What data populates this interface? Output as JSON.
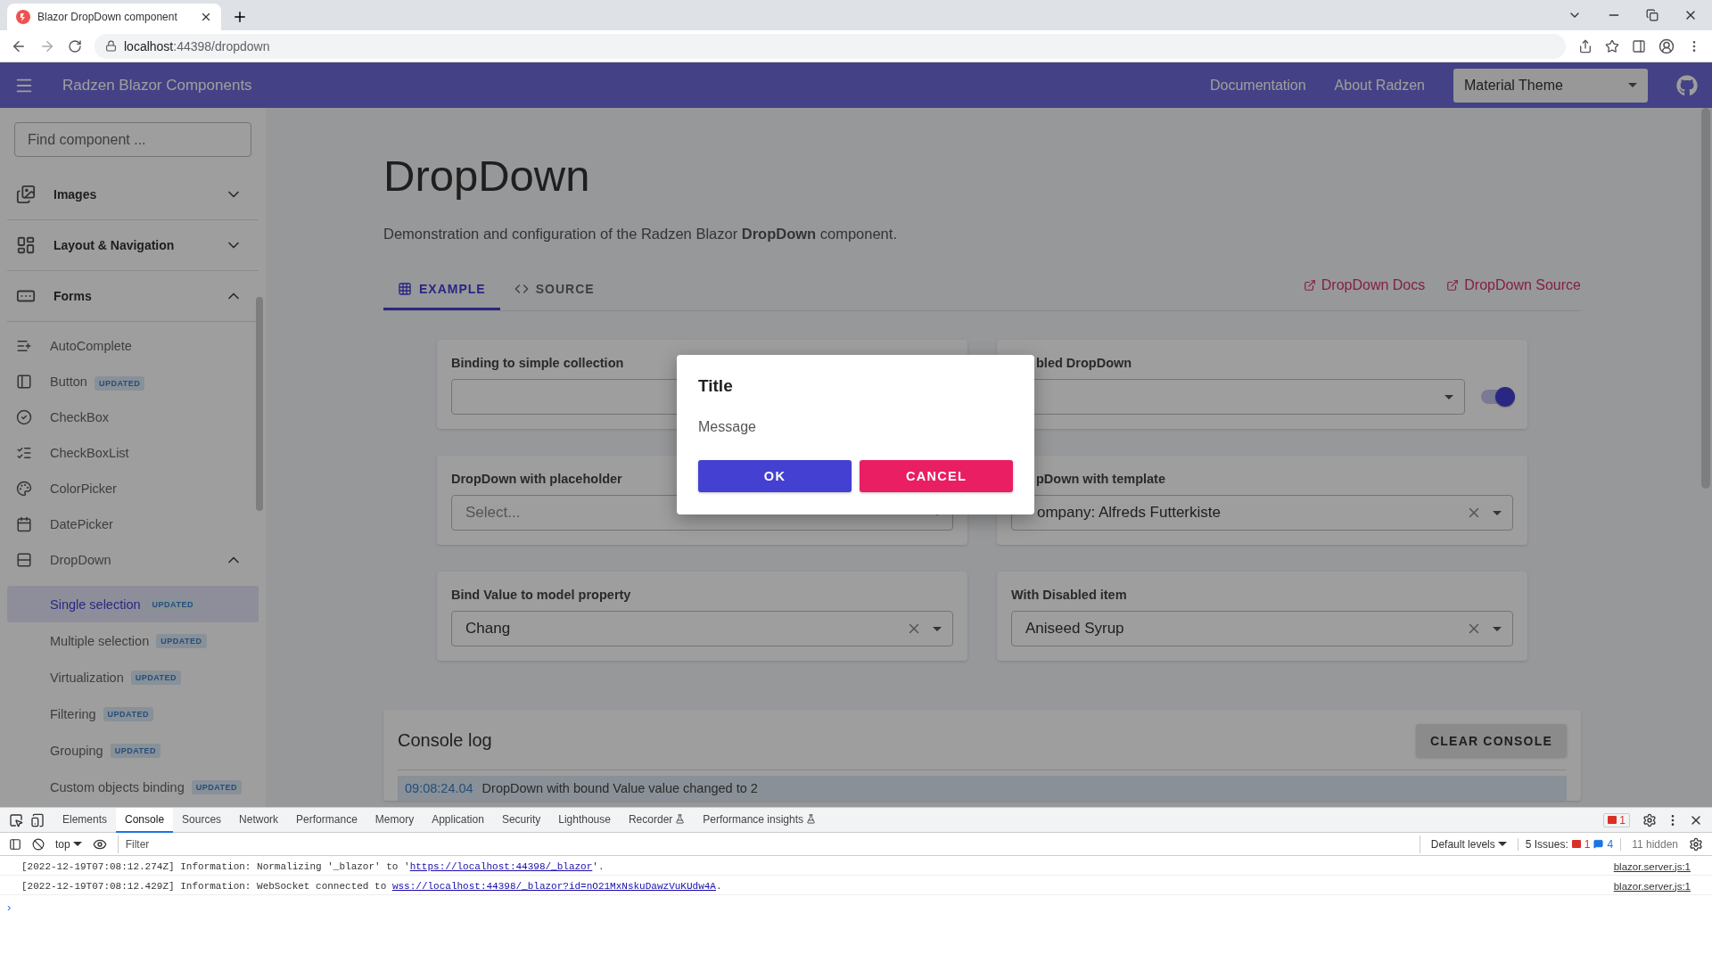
{
  "browser": {
    "tab_title": "Blazor DropDown component",
    "url_host": "localhost",
    "url_path": ":44398/dropdown"
  },
  "header": {
    "title": "Radzen Blazor Components",
    "links": [
      "Documentation",
      "About Radzen"
    ],
    "theme": "Material Theme"
  },
  "sidebar": {
    "search_placeholder": "Find component ...",
    "items": [
      {
        "label": "Images",
        "expanded": false
      },
      {
        "label": "Layout & Navigation",
        "expanded": false
      },
      {
        "label": "Forms",
        "expanded": true,
        "children": [
          {
            "label": "AutoComplete"
          },
          {
            "label": "Button",
            "badge": "UPDATED"
          },
          {
            "label": "CheckBox"
          },
          {
            "label": "CheckBoxList"
          },
          {
            "label": "ColorPicker"
          },
          {
            "label": "DatePicker"
          },
          {
            "label": "DropDown",
            "expanded": true,
            "children": [
              {
                "label": "Single selection",
                "badge": "UPDATED",
                "selected": true
              },
              {
                "label": "Multiple selection",
                "badge": "UPDATED",
                "selected": false
              },
              {
                "label": "Virtualization",
                "badge": "UPDATED",
                "selected": false
              },
              {
                "label": "Filtering",
                "badge": "UPDATED",
                "selected": false
              },
              {
                "label": "Grouping",
                "badge": "UPDATED",
                "selected": false
              },
              {
                "label": "Custom objects binding",
                "badge": "UPDATED",
                "selected": false
              }
            ]
          }
        ]
      }
    ]
  },
  "main": {
    "title": "DropDown",
    "description": "Demonstration and configuration of the Radzen Blazor **DropDown** component.",
    "tabs": [
      {
        "label": "EXAMPLE",
        "selected": true
      },
      {
        "label": "SOURCE",
        "selected": false
      }
    ],
    "links": [
      "DropDown Docs",
      "DropDown Source"
    ],
    "cards": [
      {
        "label": "Binding to simple collection",
        "clearable": false
      },
      {
        "label": "bled DropDown",
        "clearable": false,
        "switch": {
          "on": true
        }
      },
      {
        "label": "DropDown with placeholder",
        "placeholder": "Select...",
        "clearable": false
      },
      {
        "label": "pDown with template",
        "value": "ompany: Alfreds Futterkiste",
        "clearable": true
      },
      {
        "label": "Bind Value to model property",
        "value": "Chang",
        "clearable": true
      },
      {
        "label": "With Disabled item",
        "value": "Aniseed Syrup",
        "clearable": true
      }
    ],
    "console": {
      "title": "Console log",
      "clear_button": "CLEAR CONSOLE",
      "entries": [
        {
          "time": "09:08:24.04",
          "text": "DropDown with bound Value value changed to 2"
        }
      ]
    }
  },
  "dialog": {
    "title": "Title",
    "message": "Message",
    "buttons": [
      {
        "label": "OK",
        "kind": "primary"
      },
      {
        "label": "CANCEL",
        "kind": "danger"
      }
    ]
  },
  "devtools": {
    "tabs": [
      {
        "label": "Elements",
        "selected": false,
        "experimental": false
      },
      {
        "label": "Console",
        "selected": true,
        "experimental": false
      },
      {
        "label": "Sources",
        "selected": false,
        "experimental": false
      },
      {
        "label": "Network",
        "selected": false,
        "experimental": false
      },
      {
        "label": "Performance",
        "selected": false,
        "experimental": false
      },
      {
        "label": "Memory",
        "selected": false,
        "experimental": false
      },
      {
        "label": "Application",
        "selected": false,
        "experimental": false
      },
      {
        "label": "Security",
        "selected": false,
        "experimental": false
      },
      {
        "label": "Lighthouse",
        "selected": false,
        "experimental": false
      },
      {
        "label": "Recorder",
        "selected": false,
        "experimental": true
      },
      {
        "label": "Performance insights",
        "selected": false,
        "experimental": true
      }
    ],
    "prompt": "›",
    "error_badge": "1",
    "context": "top",
    "filter_placeholder": "Filter",
    "levels": "Default levels",
    "issues_label": "5 Issues:",
    "issues_errors": "1",
    "issues_messages": "4",
    "hidden": "11 hidden",
    "logs": [
      {
        "before": "[2022-12-19T07:08:12.274Z] Information: Normalizing '_blazor' to '",
        "link": "https://localhost:44398/_blazor",
        "after": "'.",
        "source": "blazor.server.js:1"
      },
      {
        "before": "[2022-12-19T07:08:12.429Z] Information: WebSocket connected to ",
        "link": "wss://localhost:44398/_blazor?id=nO21MxNskuDawzVuKUdw4A",
        "after": ".",
        "source": "blazor.server.js:1"
      }
    ]
  }
}
